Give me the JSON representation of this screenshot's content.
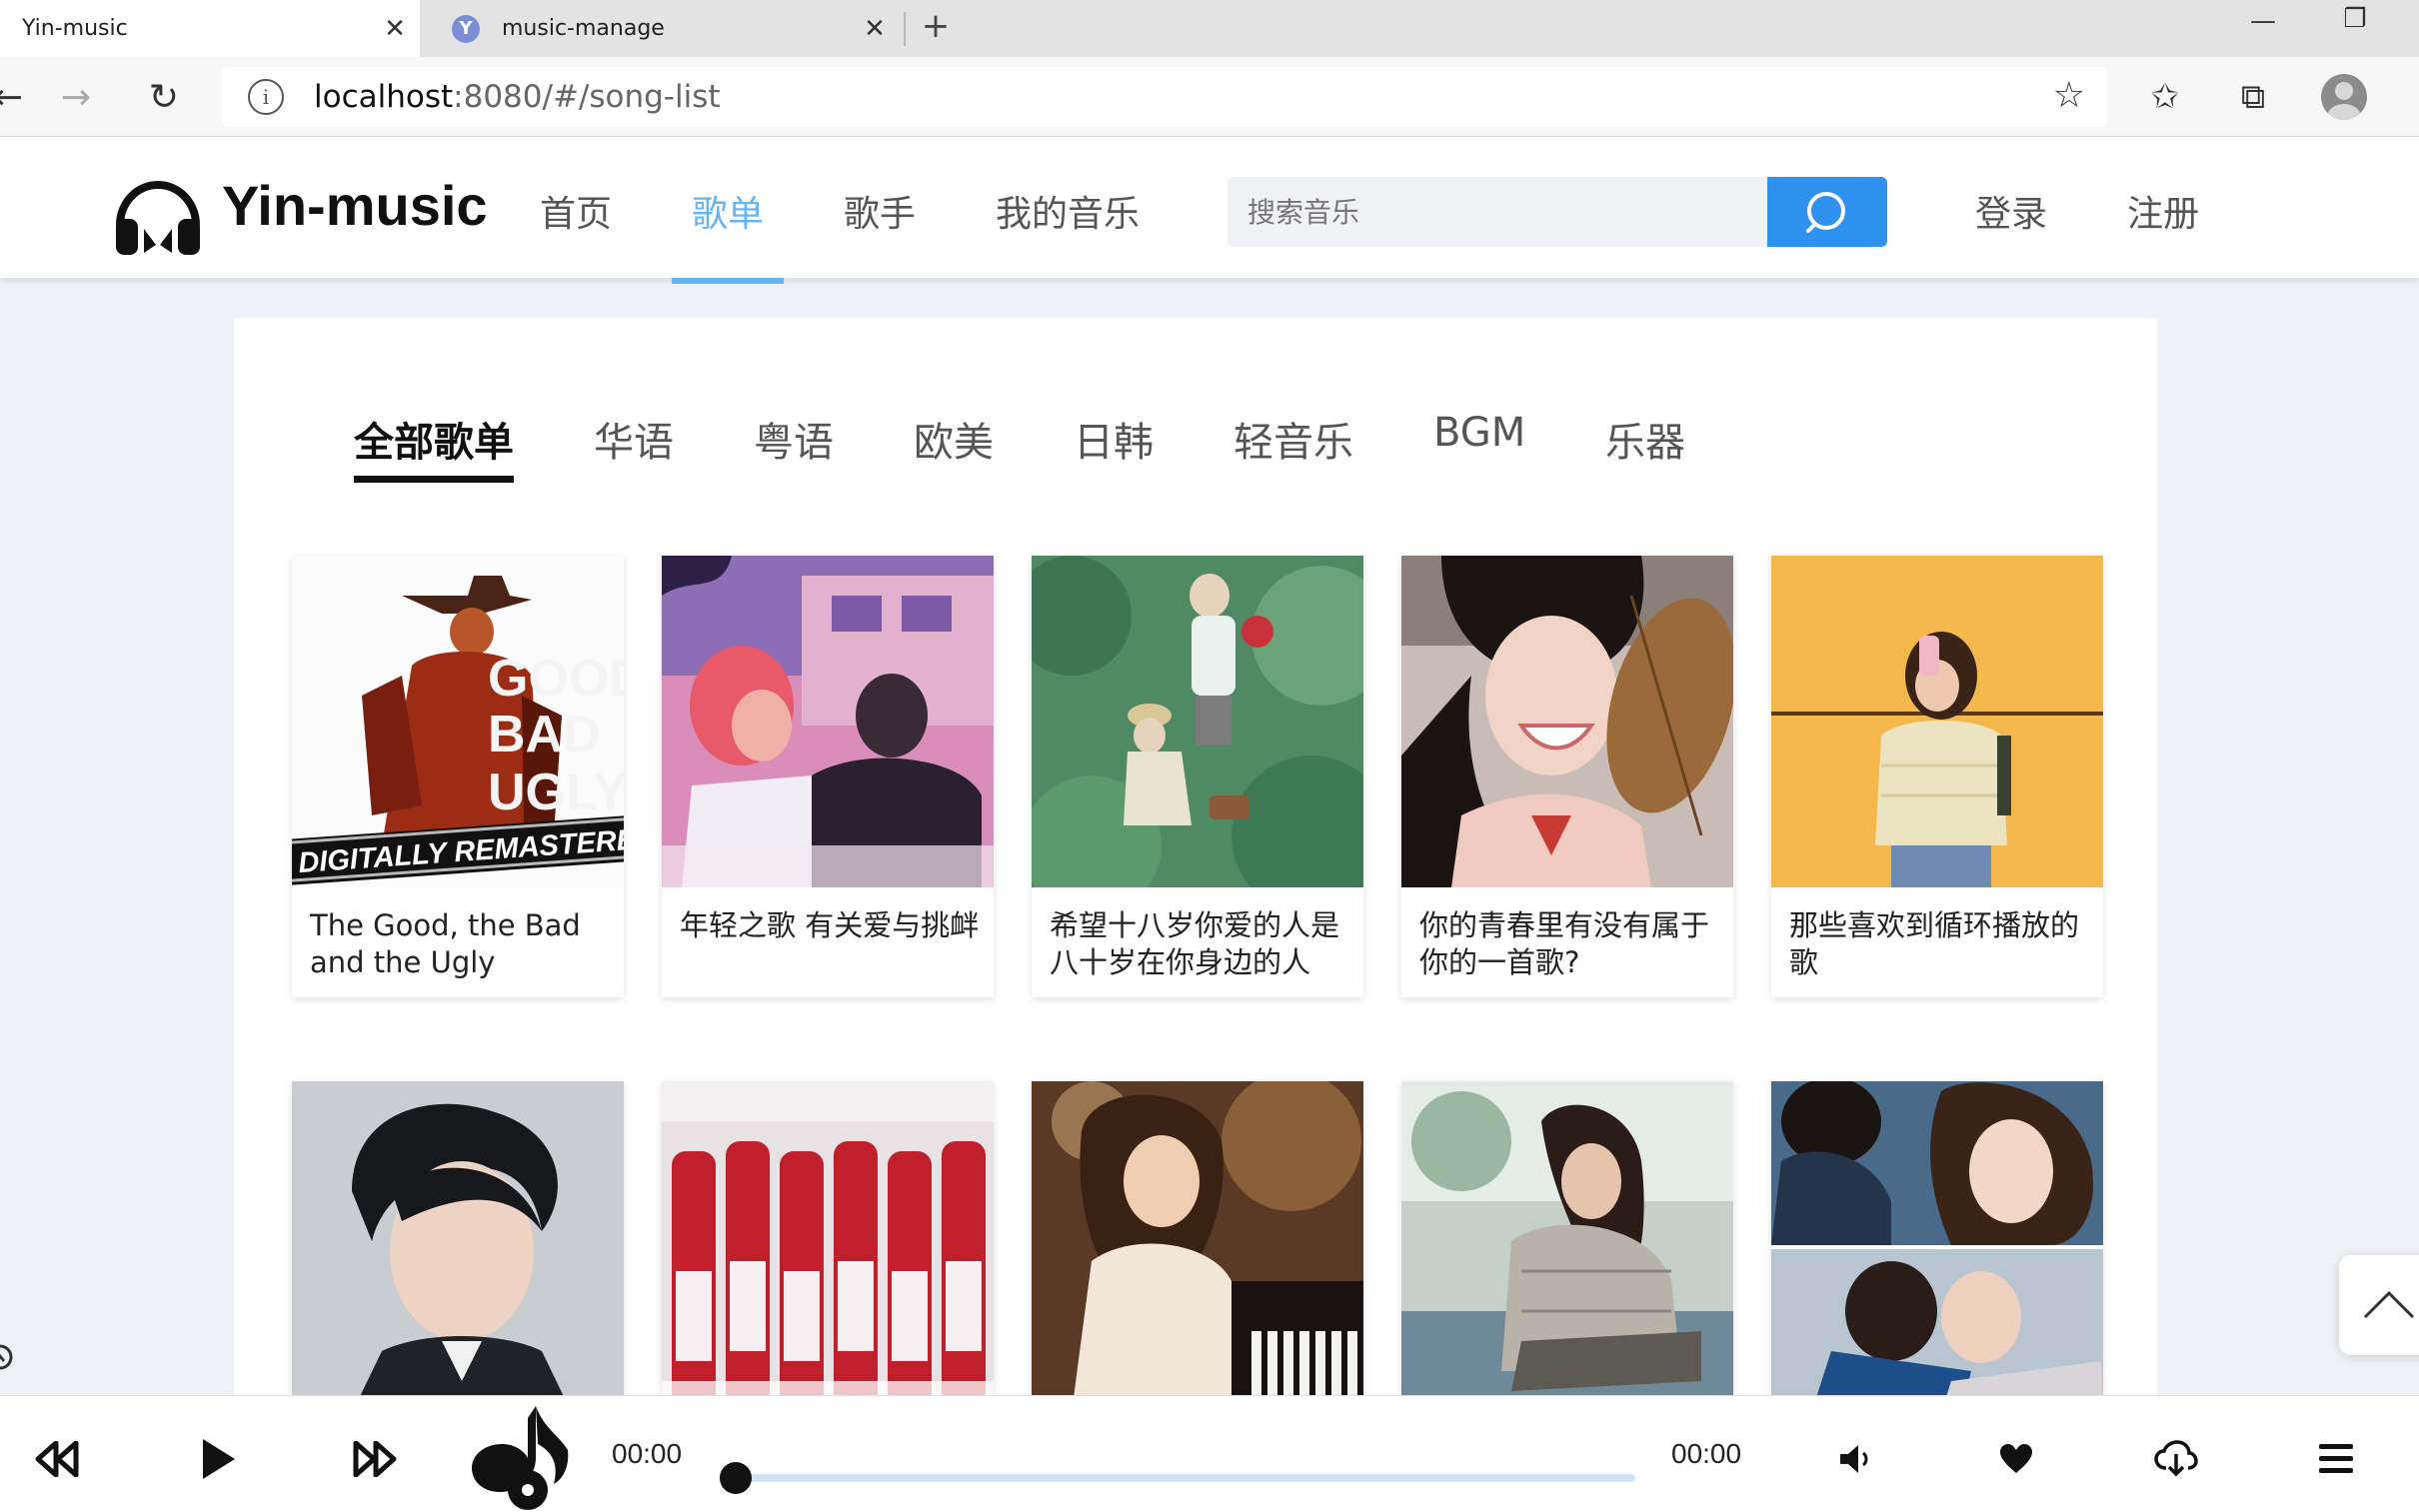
{
  "browser": {
    "tabs": [
      {
        "title": "Yin-music",
        "active": true
      },
      {
        "title": "music-manage",
        "active": false,
        "favicon": "Y"
      }
    ],
    "url_host": "localhost",
    "url_path": ":8080/#/song-list"
  },
  "header": {
    "logo_text": "Yin-music",
    "nav": [
      "首页",
      "歌单",
      "歌手",
      "我的音乐"
    ],
    "active_nav": "歌单",
    "search_placeholder": "搜索音乐",
    "login": "登录",
    "register": "注册",
    "accent_color": "#64b5f6"
  },
  "categories": {
    "items": [
      "全部歌单",
      "华语",
      "粤语",
      "欧美",
      "日韩",
      "轻音乐",
      "BGM",
      "乐器"
    ],
    "active": "全部歌单"
  },
  "playlists": [
    {
      "title": "The Good, the Bad and the Ugly",
      "cover_text_1": "GOOD",
      "cover_text_2": "BAD",
      "cover_text_3": "UGLY",
      "cover_banner": "DIGITALLY REMASTERED"
    },
    {
      "title": "年轻之歌 有关爱与挑衅"
    },
    {
      "title": "希望十八岁你爱的人是八十岁在你身边的人"
    },
    {
      "title": "你的青春里有没有属于你的一首歌?"
    },
    {
      "title": "那些喜欢到循环播放的歌"
    },
    {
      "title": ""
    },
    {
      "title": ""
    },
    {
      "title": ""
    },
    {
      "title": ""
    },
    {
      "title": ""
    }
  ],
  "player": {
    "current_time": "00:00",
    "total_time": "00:00",
    "progress": 0
  },
  "icons": [
    "close-icon",
    "plus-icon",
    "back-arrow-icon",
    "forward-arrow-icon",
    "refresh-icon",
    "info-icon",
    "star-icon",
    "favorites-icon",
    "collections-icon",
    "profile-icon",
    "headphones-icon",
    "search-icon",
    "chevron-up-icon",
    "rewind-icon",
    "play-icon",
    "fast-forward-icon",
    "music-note-icon",
    "volume-icon",
    "heart-icon",
    "download-icon",
    "menu-icon"
  ]
}
